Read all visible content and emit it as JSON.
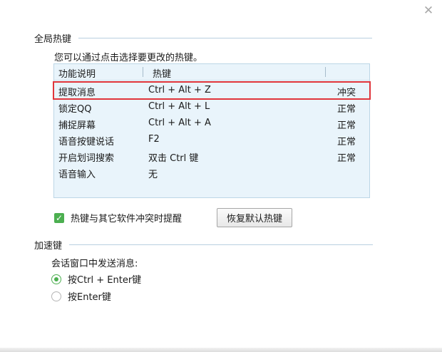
{
  "global_hotkeys": {
    "title": "全局热键",
    "hint": "您可以通过点击选择要更改的热键。",
    "columns": [
      "功能说明",
      "热键"
    ],
    "rows": [
      {
        "name": "提取消息",
        "key": "Ctrl + Alt + Z",
        "status": "冲突"
      },
      {
        "name": "锁定QQ",
        "key": "Ctrl + Alt + L",
        "status": "正常"
      },
      {
        "name": "捕捉屏幕",
        "key": "Ctrl + Alt + A",
        "status": "正常"
      },
      {
        "name": "语音按键说话",
        "key": "F2",
        "status": "正常"
      },
      {
        "name": "开启划词搜索",
        "key": "双击 Ctrl 键",
        "status": "正常"
      },
      {
        "name": "语音输入",
        "key": "无",
        "status": ""
      }
    ],
    "conflict_reminder_label": "热键与其它软件冲突时提醒",
    "conflict_reminder_checked": true,
    "restore_default_label": "恢复默认热键"
  },
  "accelerator": {
    "title": "加速键",
    "send_label": "会话窗口中发送消息:",
    "options": [
      {
        "label": "按Ctrl + Enter键",
        "checked": true
      },
      {
        "label": "按Enter键",
        "checked": false
      }
    ]
  },
  "colors": {
    "conflict_outline": "#e0353b",
    "check_green": "#4caf50",
    "table_bg": "#e9f4fb"
  }
}
